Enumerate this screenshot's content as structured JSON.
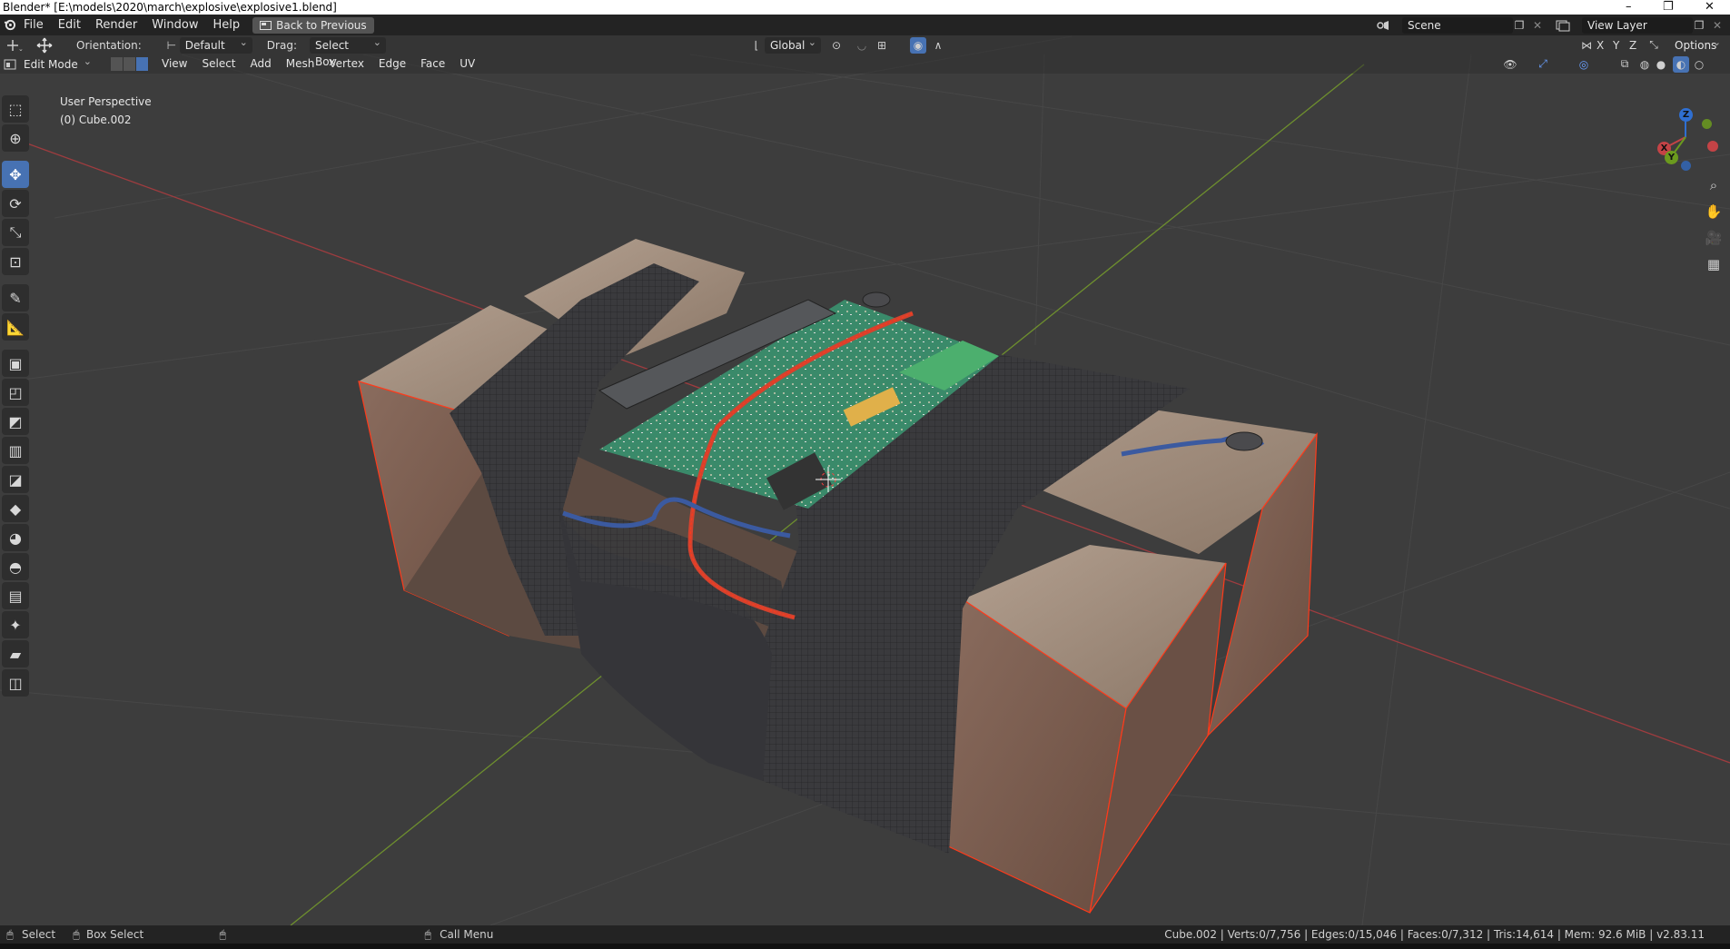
{
  "window": {
    "title": "Blender* [E:\\models\\2020\\march\\explosive\\explosive1.blend]",
    "controls": [
      "–",
      "❐",
      "✕"
    ]
  },
  "menu": {
    "items": [
      "File",
      "Edit",
      "Render",
      "Window",
      "Help"
    ],
    "back_button": "Back to Previous",
    "scene_label": "Scene",
    "view_layer_label": "View Layer"
  },
  "tool_header": {
    "orientation_label": "Orientation:",
    "orientation_value": "Default",
    "drag_label": "Drag:",
    "drag_value": "Select Box",
    "transform_orientation": "Global",
    "axes": [
      "X",
      "Y",
      "Z"
    ],
    "options_label": "Options"
  },
  "viewport_header": {
    "mode": "Edit Mode",
    "menus": [
      "View",
      "Select",
      "Add",
      "Mesh",
      "Vertex",
      "Edge",
      "Face",
      "UV"
    ]
  },
  "viewport": {
    "perspective_label": "User Perspective",
    "object_label": "(0) Cube.002",
    "gizmo_axes": {
      "x": "X",
      "y": "Y",
      "z": "Z"
    },
    "colors": {
      "x_axis": "#c44346",
      "y_axis": "#6b9a1e",
      "background": "#3d3d3d",
      "selection": "#ff3a1a"
    }
  },
  "toolbar": {
    "tools": [
      "select-box-icon",
      "cursor-icon",
      "move-icon",
      "rotate-icon",
      "scale-icon",
      "transform-icon",
      "annotate-icon",
      "measure-icon",
      "extrude-icon",
      "inset-icon",
      "bevel-icon",
      "loop-cut-icon",
      "knife-icon",
      "poly-build-icon",
      "spin-icon",
      "smooth-icon",
      "edge-slide-icon",
      "shrink-fatten-icon",
      "shear-icon",
      "rip-icon"
    ],
    "active_tool": "move-icon"
  },
  "statusbar": {
    "select": "Select",
    "box_select": "Box Select",
    "call_menu": "Call Menu",
    "stats": "Cube.002 | Verts:0/7,756 | Edges:0/15,046 | Faces:0/7,312 | Tris:14,614 | Mem: 92.6 MiB | v2.83.11"
  }
}
